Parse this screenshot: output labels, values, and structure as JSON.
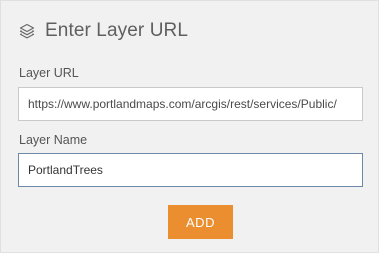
{
  "header": {
    "icon": "layers-icon",
    "title": "Enter Layer URL"
  },
  "form": {
    "url_label": "Layer URL",
    "url_value": "https://www.portlandmaps.com/arcgis/rest/services/Public/",
    "name_label": "Layer Name",
    "name_value": "PortlandTrees",
    "add_label": "ADD"
  },
  "colors": {
    "panel_background": "#f1f1f1",
    "add_button": "#eb8e2f",
    "focused_border": "#6e88a8"
  }
}
